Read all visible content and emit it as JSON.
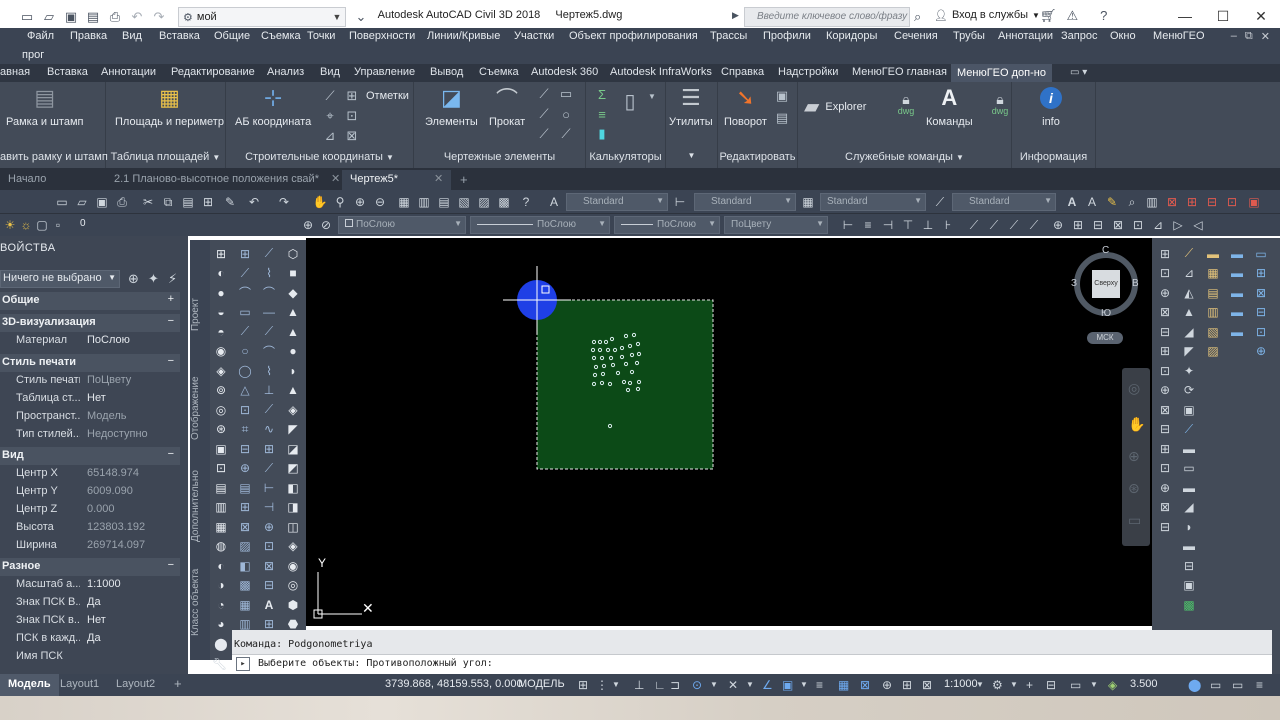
{
  "titlebar": {
    "workspace": "мой",
    "app_name": "Autodesk AutoCAD Civil 3D 2018",
    "file_name": "Чертеж5.dwg",
    "search_placeholder": "Введите ключевое слово/фразу",
    "signin": "Вход в службы",
    "minimize": "—",
    "maximize": "☐",
    "close": "✕"
  },
  "menubar": {
    "items": [
      "Файл",
      "Правка",
      "Вид",
      "Вставка",
      "Общие",
      "Съемка",
      "Точки",
      "Поверхности",
      "Линии/Кривые",
      "Участки",
      "Объект профилирования",
      "Трассы",
      "Профили",
      "Коридоры",
      "Сечения",
      "Трубы",
      "Аннотации",
      "Запрос",
      "Окно",
      "МенюГЕО"
    ],
    "overflow": "прог"
  },
  "ribbon_tabs": [
    "авная",
    "Вставка",
    "Аннотации",
    "Редактирование",
    "Анализ",
    "Вид",
    "Управление",
    "Вывод",
    "Съемка",
    "Autodesk 360",
    "Autodesk InfraWorks",
    "Справка",
    "Надстройки",
    "МенюГЕО главная",
    "МенюГЕО доп-но"
  ],
  "ribbon": {
    "frame_button": "Рамка и штамп",
    "area_button": "Площадь и периметр",
    "ab_button": "АБ координата",
    "marks_button": "Отметки",
    "elements_button": "Элементы",
    "profile_button": "Прокат",
    "utilities_button": "Утилиты",
    "rotate_button": "Поворот",
    "explorer_button": "Explorer",
    "commands_button": "Команды",
    "info_button": "info",
    "dwg_label": "dwg",
    "groups": [
      "авить рамку и штамп",
      "Таблица площадей",
      "Строительные координаты",
      "Чертежные элементы",
      "Калькуляторы",
      "Редактировать",
      "Служебные команды",
      "Информация"
    ]
  },
  "doc_tabs": [
    "Начало",
    "2.1 Планово-высотное положения свай*",
    "Чертеж5*"
  ],
  "toolbar": {
    "styles": [
      "Standard",
      "Standard",
      "Standard",
      "Standard"
    ],
    "layer": "0",
    "color": "ПоСлою",
    "linetype": "ПоСлою",
    "lineweight": "ПоСлою",
    "plotstyle": "ПоЦвету"
  },
  "properties": {
    "title": "ВОЙСТВА",
    "selection": "Ничего не выбрано",
    "sections": [
      {
        "name": "Общие",
        "sign": "+",
        "rows": []
      },
      {
        "name": "3D-визуализация",
        "sign": "−",
        "rows": [
          {
            "k": "Материал",
            "v": "ПоСлою",
            "dim": false
          }
        ]
      },
      {
        "name": "Стиль печати",
        "sign": "−",
        "rows": [
          {
            "k": "Стиль печати",
            "v": "ПоЦвету",
            "dim": true
          },
          {
            "k": "Таблица ст...",
            "v": "Нет",
            "dim": false
          },
          {
            "k": "Пространст...",
            "v": "Модель",
            "dim": true
          },
          {
            "k": "Тип стилей...",
            "v": "Недоступно",
            "dim": true
          }
        ]
      },
      {
        "name": "Вид",
        "sign": "−",
        "rows": [
          {
            "k": "Центр X",
            "v": "65148.974",
            "dim": true
          },
          {
            "k": "Центр Y",
            "v": "6009.090",
            "dim": true
          },
          {
            "k": "Центр Z",
            "v": "0.000",
            "dim": true
          },
          {
            "k": "Высота",
            "v": "123803.192",
            "dim": true
          },
          {
            "k": "Ширина",
            "v": "269714.097",
            "dim": true
          }
        ]
      },
      {
        "name": "Разное",
        "sign": "−",
        "rows": [
          {
            "k": "Масштаб а...",
            "v": "1:1000",
            "dim": false
          },
          {
            "k": "Знак ПСК В...",
            "v": "Да",
            "dim": false
          },
          {
            "k": "Знак ПСК в...",
            "v": "Нет",
            "dim": false
          },
          {
            "k": "ПСК в кажд...",
            "v": "Да",
            "dim": false
          },
          {
            "k": "Имя ПСК",
            "v": "",
            "dim": false
          }
        ]
      }
    ],
    "side_tabs": [
      "Проект",
      "Отображение",
      "Дополнительно",
      "Класс объекта"
    ]
  },
  "viewcube": {
    "north": "С",
    "south": "Ю",
    "west": "З",
    "east": "В",
    "face": "Сверху",
    "wcs": "МСК"
  },
  "ucs": {
    "y": "Y",
    "x": "X"
  },
  "command": {
    "history": "Команда: Podgonometriya",
    "prompt": "Выберите объекты: Противоположный угол:"
  },
  "statusbar": {
    "layouts": [
      "Модель",
      "Layout1",
      "Layout2"
    ],
    "add": "+",
    "coords": "3739.868, 48159.553, 0.000",
    "model": "МОДЕЛЬ",
    "scale": "1:1000",
    "annotation_value": "3.500"
  },
  "colors": {
    "canvas": "#000000",
    "selection_fill": "#0c4a17",
    "grip": "#1f3fe6",
    "points": "#d9ecec"
  }
}
